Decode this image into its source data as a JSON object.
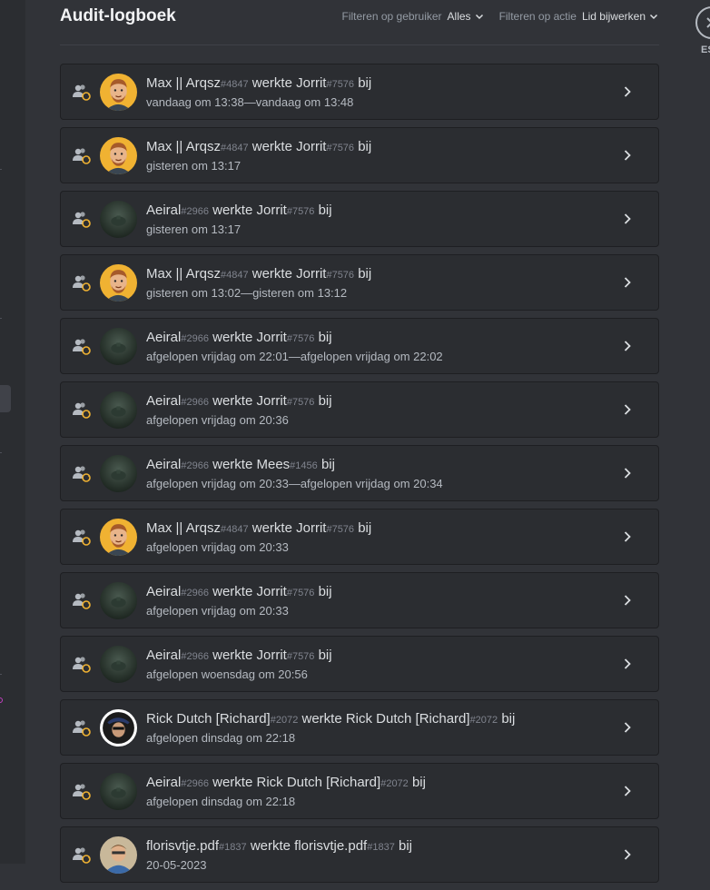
{
  "page": {
    "title": "Audit-logboek"
  },
  "filters": {
    "user_label": "Filteren op gebruiker",
    "user_value": "Alles",
    "action_label": "Filteren op actie",
    "action_value": "Lid bijwerken"
  },
  "close": {
    "label": "ESC"
  },
  "verbs": {
    "updated": "werkte",
    "suffix": "bij"
  },
  "entries": [
    {
      "actor": "Max || Arqsz",
      "actor_disc": "#4847",
      "target": "Jorrit",
      "target_disc": "#7576",
      "time": "vandaag om 13:38—vandaag om 13:48",
      "avatar": "max"
    },
    {
      "actor": "Max || Arqsz",
      "actor_disc": "#4847",
      "target": "Jorrit",
      "target_disc": "#7576",
      "time": "gisteren om 13:17",
      "avatar": "max"
    },
    {
      "actor": "Aeiral",
      "actor_disc": "#2966",
      "target": "Jorrit",
      "target_disc": "#7576",
      "time": "gisteren om 13:17",
      "avatar": "aeiral"
    },
    {
      "actor": "Max || Arqsz",
      "actor_disc": "#4847",
      "target": "Jorrit",
      "target_disc": "#7576",
      "time": "gisteren om 13:02—gisteren om 13:12",
      "avatar": "max"
    },
    {
      "actor": "Aeiral",
      "actor_disc": "#2966",
      "target": "Jorrit",
      "target_disc": "#7576",
      "time": "afgelopen vrijdag om 22:01—afgelopen vrijdag om 22:02",
      "avatar": "aeiral"
    },
    {
      "actor": "Aeiral",
      "actor_disc": "#2966",
      "target": "Jorrit",
      "target_disc": "#7576",
      "time": "afgelopen vrijdag om 20:36",
      "avatar": "aeiral"
    },
    {
      "actor": "Aeiral",
      "actor_disc": "#2966",
      "target": "Mees",
      "target_disc": "#1456",
      "time": "afgelopen vrijdag om 20:33—afgelopen vrijdag om 20:34",
      "avatar": "aeiral"
    },
    {
      "actor": "Max || Arqsz",
      "actor_disc": "#4847",
      "target": "Jorrit",
      "target_disc": "#7576",
      "time": "afgelopen vrijdag om 20:33",
      "avatar": "max"
    },
    {
      "actor": "Aeiral",
      "actor_disc": "#2966",
      "target": "Jorrit",
      "target_disc": "#7576",
      "time": "afgelopen vrijdag om 20:33",
      "avatar": "aeiral"
    },
    {
      "actor": "Aeiral",
      "actor_disc": "#2966",
      "target": "Jorrit",
      "target_disc": "#7576",
      "time": "afgelopen woensdag om 20:56",
      "avatar": "aeiral"
    },
    {
      "actor": "Rick Dutch [Richard]",
      "actor_disc": "#2072",
      "target": "Rick Dutch [Richard]",
      "target_disc": "#2072",
      "time": "afgelopen dinsdag om 22:18",
      "avatar": "rick"
    },
    {
      "actor": "Aeiral",
      "actor_disc": "#2966",
      "target": "Rick Dutch [Richard]",
      "target_disc": "#2072",
      "time": "afgelopen dinsdag om 22:18",
      "avatar": "aeiral"
    },
    {
      "actor": "florisvtje.pdf",
      "actor_disc": "#1837",
      "target": "florisvtje.pdf",
      "target_disc": "#1837",
      "time": "20-05-2023",
      "avatar": "floris"
    }
  ],
  "colors": {
    "background": "#313338",
    "row": "#2b2d31",
    "update_icon_accent": "#f0b232",
    "max_avatar_bg": "#f0b232"
  }
}
